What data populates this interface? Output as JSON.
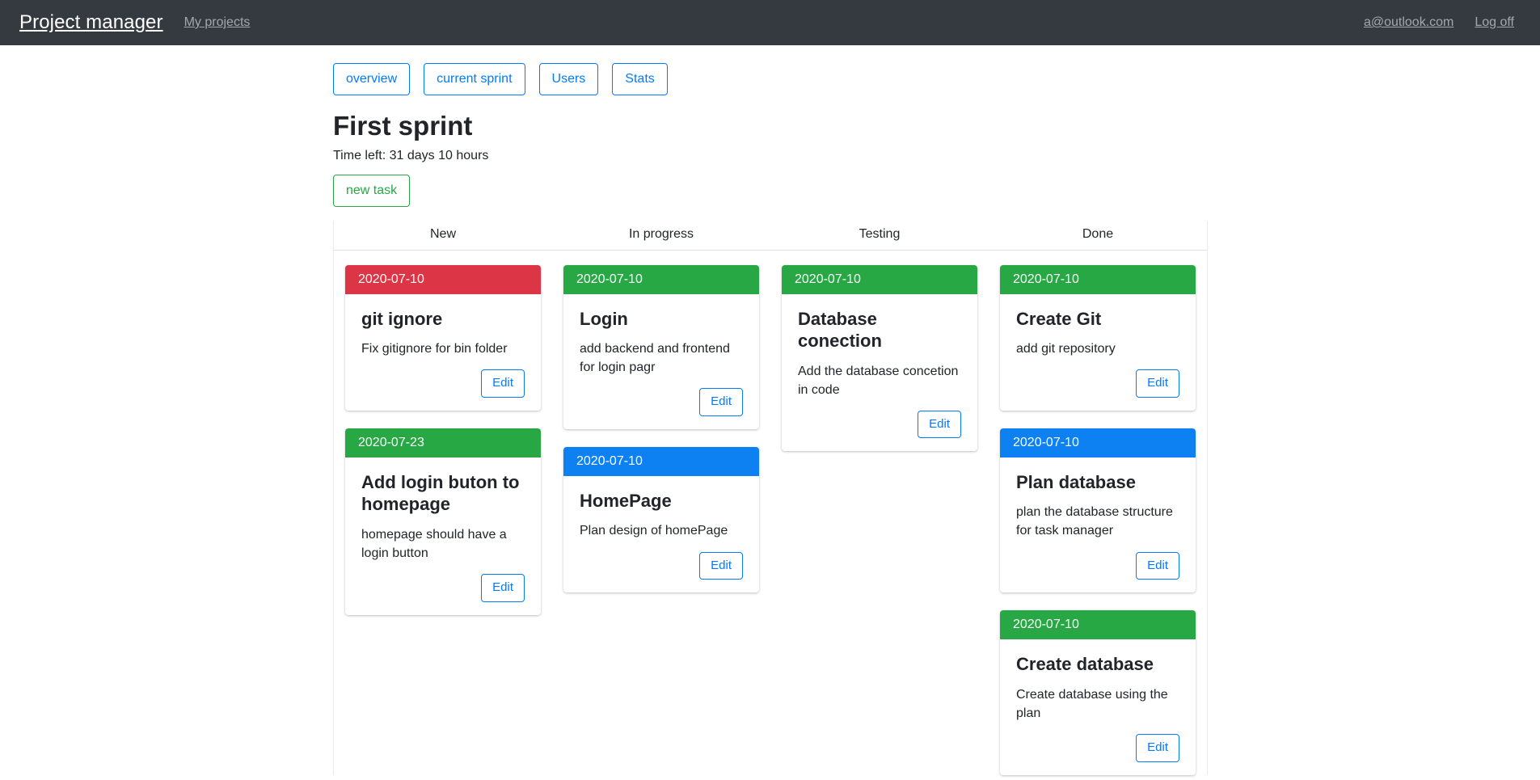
{
  "navbar": {
    "brand": "Project manager",
    "my_projects": "My projects",
    "user_email": "a@outlook.com",
    "log_off": "Log off"
  },
  "tabs": [
    {
      "label": "overview"
    },
    {
      "label": "current sprint"
    },
    {
      "label": "Users"
    },
    {
      "label": "Stats"
    }
  ],
  "sprint": {
    "title": "First sprint",
    "time_left": "Time left: 31 days 10 hours",
    "new_task_label": "new task"
  },
  "colors": {
    "navbar_bg": "#343a40",
    "primary": "#007bff",
    "success": "#28a745",
    "danger": "#dc3545",
    "info_blue": "#0d80f2"
  },
  "edit_label": "Edit",
  "board": {
    "columns": [
      {
        "name": "New",
        "cards": [
          {
            "date": "2020-07-10",
            "color": "red",
            "title": "git ignore",
            "text": "Fix gitignore for bin folder"
          },
          {
            "date": "2020-07-23",
            "color": "green",
            "title": "Add login buton to homepage",
            "text": "homepage should have a login button"
          }
        ]
      },
      {
        "name": "In progress",
        "cards": [
          {
            "date": "2020-07-10",
            "color": "green",
            "title": "Login",
            "text": "add backend and frontend for login pagr"
          },
          {
            "date": "2020-07-10",
            "color": "blue",
            "title": "HomePage",
            "text": "Plan design of homePage"
          }
        ]
      },
      {
        "name": "Testing",
        "cards": [
          {
            "date": "2020-07-10",
            "color": "green",
            "title": "Database conection",
            "text": "Add the database concetion in code"
          }
        ]
      },
      {
        "name": "Done",
        "cards": [
          {
            "date": "2020-07-10",
            "color": "green",
            "title": "Create Git",
            "text": "add git repository"
          },
          {
            "date": "2020-07-10",
            "color": "blue",
            "title": "Plan database",
            "text": "plan the database structure for task manager"
          },
          {
            "date": "2020-07-10",
            "color": "green",
            "title": "Create database",
            "text": "Create database using the plan"
          }
        ]
      }
    ]
  }
}
